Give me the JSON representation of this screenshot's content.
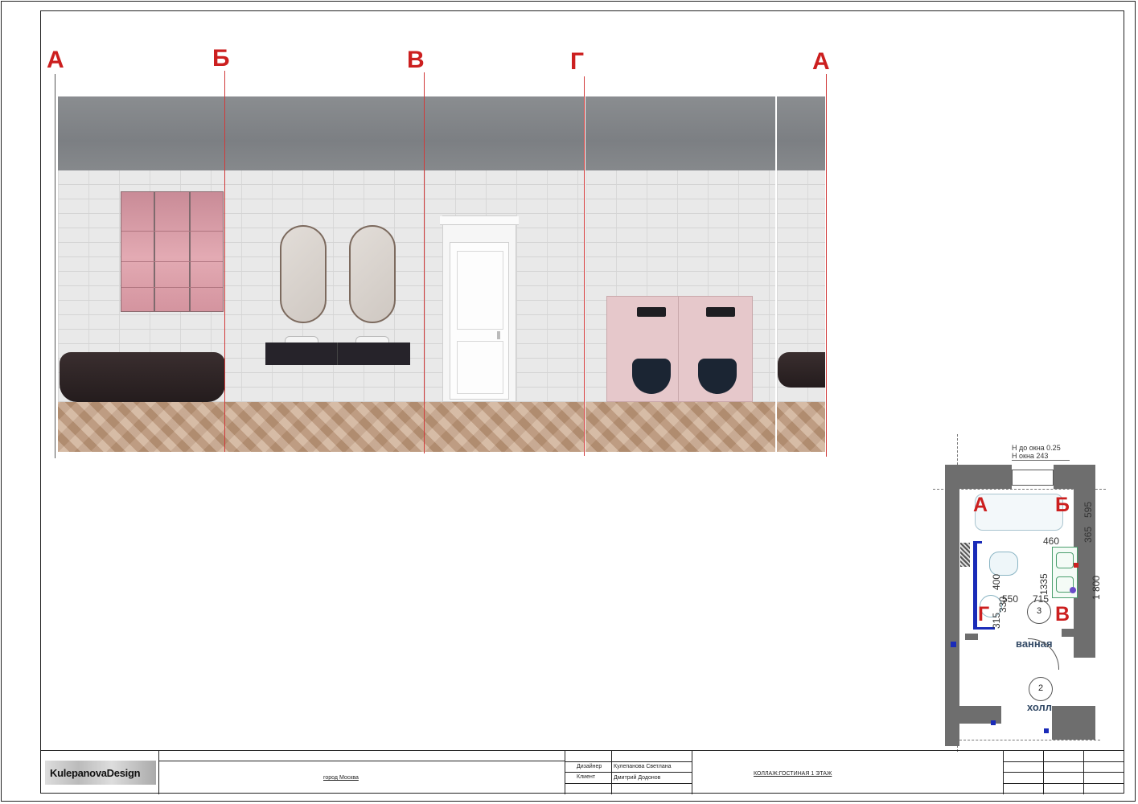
{
  "section_labels": {
    "a_left": "А",
    "b": "Б",
    "v": "В",
    "g": "Г",
    "a_right": "А"
  },
  "plan": {
    "window_height_note": "Н до окна 0.25",
    "window_size_note": "Н окна 243",
    "label_a": "А",
    "label_b": "Б",
    "label_v": "В",
    "label_g": "Г",
    "dim_460": "460",
    "dim_365": "365",
    "dim_595": "595",
    "dim_1335": "1335",
    "dim_400": "400",
    "dim_550": "550",
    "dim_715": "715",
    "dim_315": "315",
    "dim_330": "330",
    "dim_1800": "1 800",
    "room3_number": "3",
    "room3_name": "ванная",
    "room2_number": "2",
    "room2_name": "холл"
  },
  "title_block": {
    "logo": "KulepanovaDesign",
    "city": "город Москва",
    "designer_label": "Дизайнер",
    "designer_name": "Кулепанова Светлана",
    "client_label": "Клиент",
    "client_name": "Дмитрий Додонов",
    "sheet_title": "КОЛЛАЖ:ГОСТИНАЯ 1 ЭТАЖ"
  },
  "colors": {
    "section_red": "#cc1f1f",
    "plan_blue": "#1a2bb8",
    "vanity_pink": "#e8c9cc",
    "blind_pink": "#d99aa5",
    "fixture_dark": "#2a2224",
    "toilet_navy": "#1b2533"
  }
}
